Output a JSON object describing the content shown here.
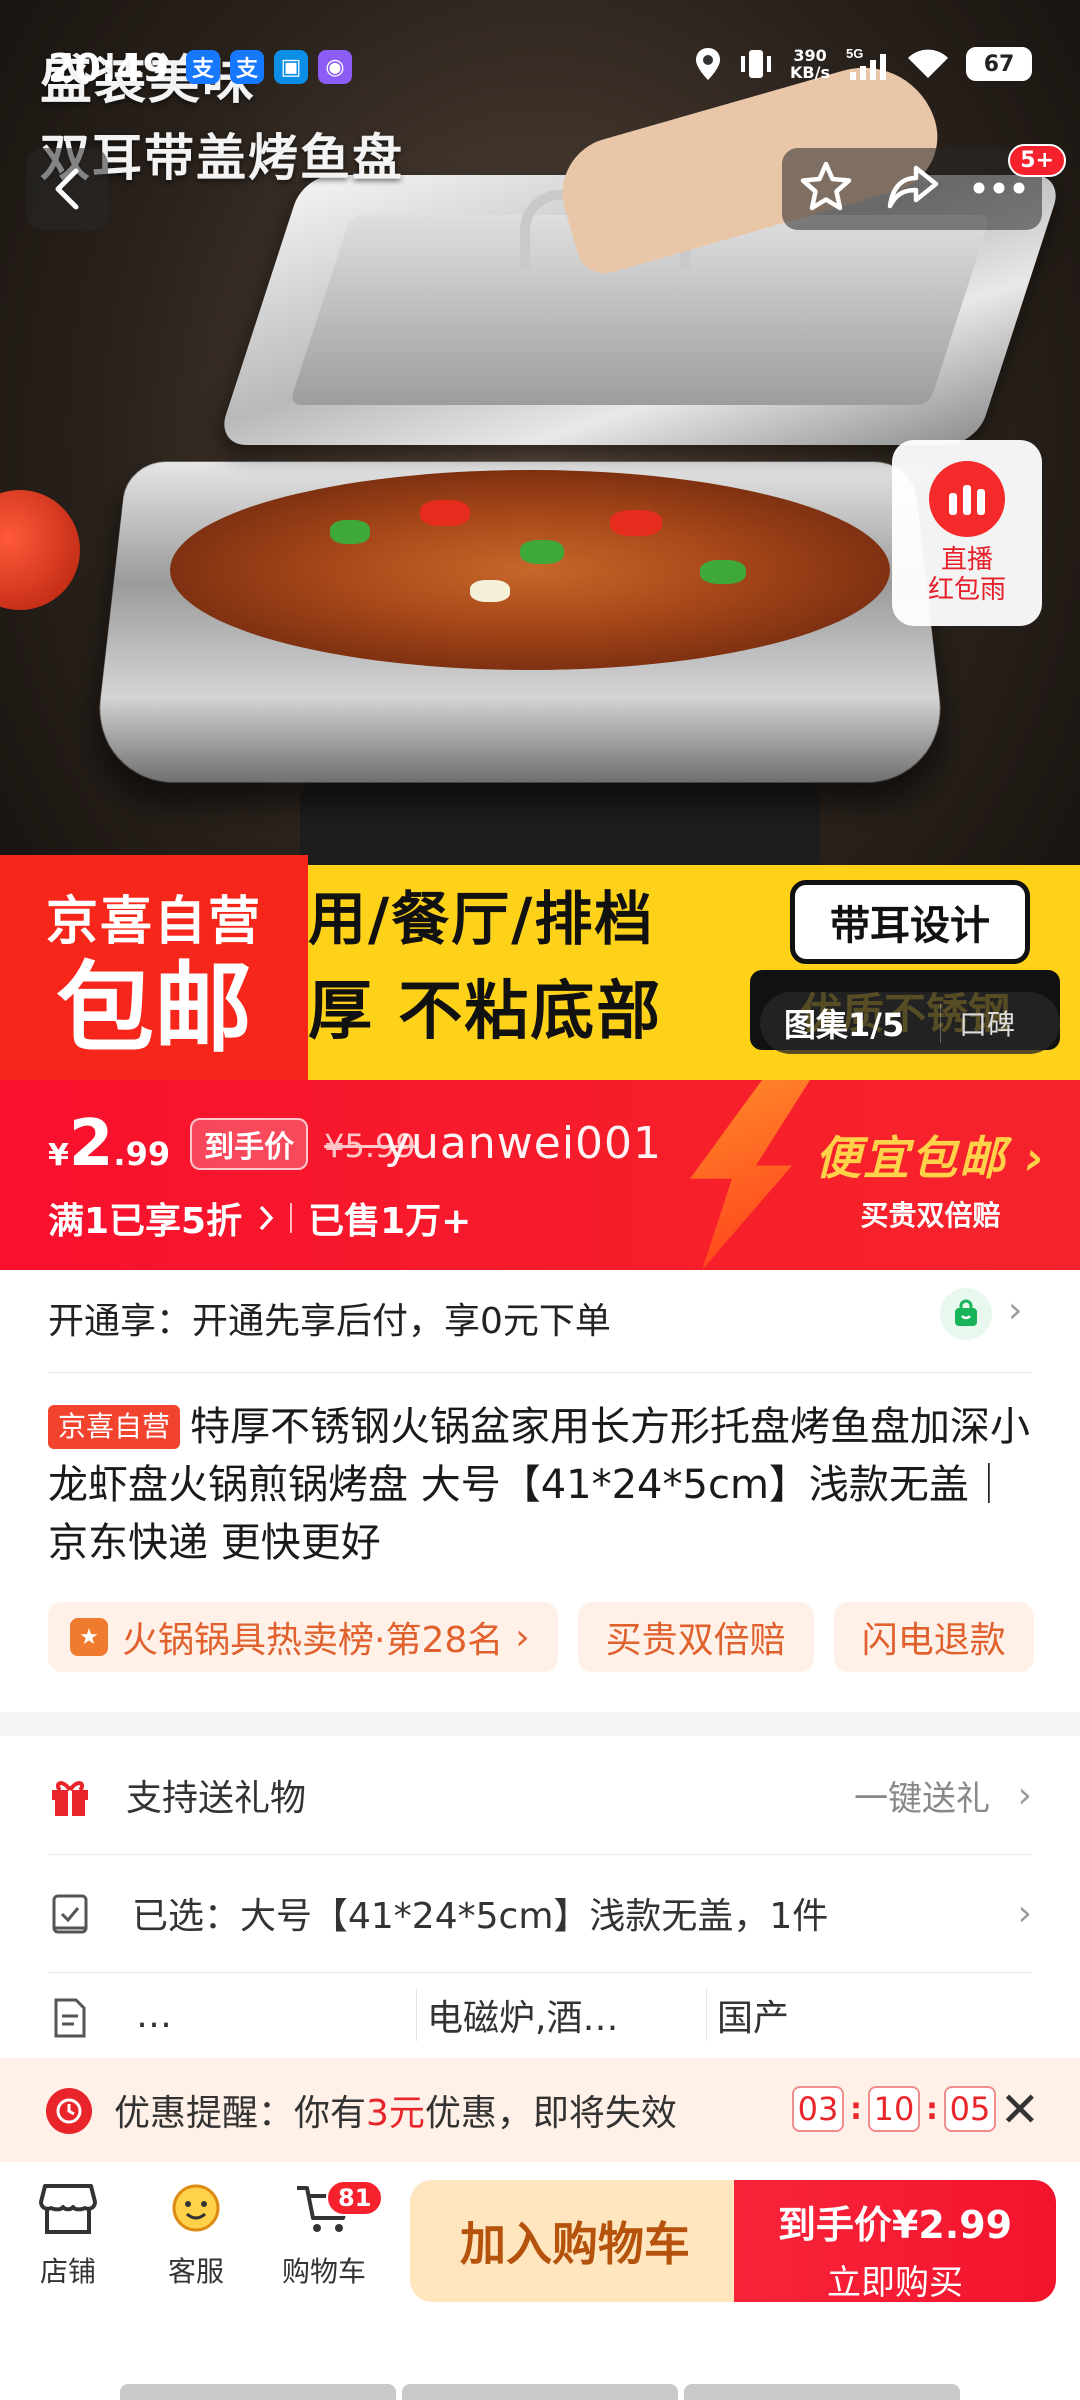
{
  "status_bar": {
    "time": "20:49",
    "app_icons": [
      {
        "name": "alipay-icon",
        "label": "支",
        "color": "#1677ff"
      },
      {
        "name": "alipay-icon-2",
        "label": "支",
        "color": "#1677ff"
      },
      {
        "name": "app-icon-blue",
        "label": "",
        "color": "#0b8fe6"
      },
      {
        "name": "app-icon-purple",
        "label": "",
        "color": "#8b5cf6"
      }
    ],
    "net_speed_value": "390",
    "net_speed_unit": "KB/s",
    "network": "5G",
    "battery": "67"
  },
  "hero": {
    "title_line1": "盛装美味",
    "title_line2": "双耳带盖烤鱼盘",
    "cart_badge": "5+",
    "live_label": "直播\n红包雨",
    "promo_brand": "京喜自营",
    "promo_free": "包邮",
    "strip_line1": "用/餐厅/排档",
    "strip_line2": "厚 不粘底部",
    "ear_design": "带耳设计",
    "steel_quality": "优质不锈钢",
    "gallery_label": "图集1/5",
    "reviews_label": "口碑"
  },
  "price": {
    "currency": "¥",
    "integer": "2",
    "decimal": ".99",
    "tag": "到手价",
    "original": "¥5.99",
    "watermark": "yuanwei001",
    "discount": "满1已享5折",
    "sold": "已售1万+",
    "cheap_shipping": "便宜包邮",
    "cheap_guarantee": "买贵双倍赔"
  },
  "info": {
    "open_service": "开通享：开通先享后付，享0元下单",
    "title_tag": "京喜自营",
    "title": "特厚不锈钢火锅盆家用长方形托盘烤鱼盘加深小龙虾盘火锅煎锅烤盘 大号【41*24*5cm】浅款无盖｜京东快递 更快更好",
    "chips": [
      "火锅锅具热卖榜·第28名",
      "买贵双倍赔",
      "闪电退款"
    ]
  },
  "rows": {
    "gift_label": "支持送礼物",
    "gift_action": "一键送礼",
    "selected_label": "已选：大号【41*24*5cm】浅款无盖，1件",
    "spec_cells": [
      "…",
      "电磁炉,酒…",
      "国产"
    ]
  },
  "reminder": {
    "prefix": "优惠提醒：你有",
    "amount": "3元",
    "suffix": "优惠，即将失效",
    "h": "03",
    "m": "10",
    "s": "05"
  },
  "bottom": {
    "store": "店铺",
    "service": "客服",
    "cart": "购物车",
    "cart_count": "81",
    "add_to_cart": "加入购物车",
    "buy_price": "到手价¥2.99",
    "buy_now": "立即购买"
  },
  "colors": {
    "brand_red": "#f5222d",
    "promo_yellow": "#ffd21a",
    "cart_button_bg": "#ffe6bf"
  }
}
